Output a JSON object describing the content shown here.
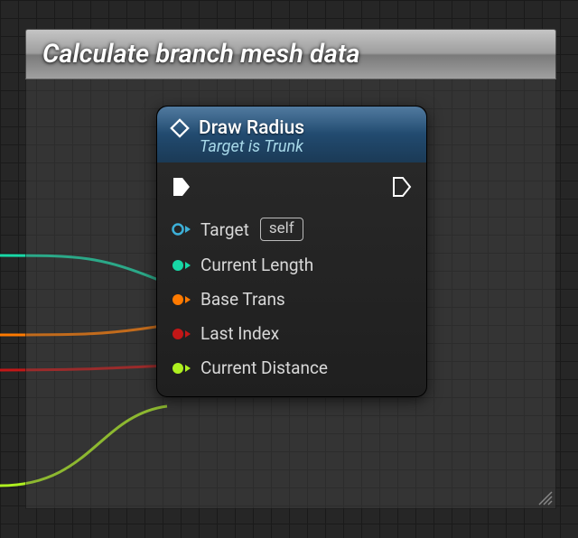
{
  "comment": {
    "title": "Calculate branch mesh data"
  },
  "node": {
    "title": "Draw Radius",
    "subtitle": "Target is Trunk",
    "inputs": {
      "target": {
        "label": "Target",
        "badge": "self",
        "color": "#3db0d8",
        "connected": false
      },
      "current_length": {
        "label": "Current Length",
        "color": "#17d8a6",
        "connected": true
      },
      "base_trans": {
        "label": "Base Trans",
        "color": "#ff7a00",
        "connected": true
      },
      "last_index": {
        "label": "Last Index",
        "color": "#c21717",
        "connected": true
      },
      "current_distance": {
        "label": "Current Distance",
        "color": "#aef020",
        "connected": true
      }
    }
  }
}
